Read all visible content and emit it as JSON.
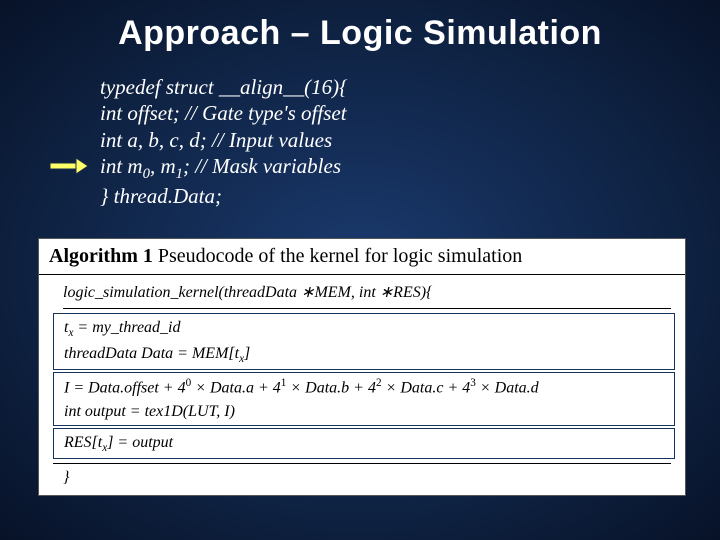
{
  "title": "Approach – Logic Simulation",
  "struct": {
    "l1": "typedef struct __align__(16){",
    "l2": "int offset; // Gate type's offset",
    "l3": "int a, b, c, d; // Input values",
    "l4_pre": "int m",
    "l4_sub0": "0",
    "l4_mid": ", m",
    "l4_sub1": "1",
    "l4_post": "; // Mask variables",
    "l5": "} thread.Data;"
  },
  "arrow_name": "arrow-right-icon",
  "algo": {
    "caption_bold": "Algorithm 1",
    "caption_rest": " Pseudocode of the kernel for logic simulation",
    "signature": "logic_simulation_kernel(threadData ∗MEM, int ∗RES){",
    "g1l1_lhs": "t",
    "g1l1_sub": "x",
    "g1l1_eq": " = my_thread_id",
    "g1l2_pre": "threadData Data = MEM[t",
    "g1l2_sub": "x",
    "g1l2_post": "]",
    "g2l1_pre": "I = Data.offset + 4",
    "g2l1_s0": "0",
    "g2l1_a": " × Data.a + 4",
    "g2l1_s1": "1",
    "g2l1_b": " × Data.b + 4",
    "g2l1_s2": "2",
    "g2l1_c": " × Data.c + 4",
    "g2l1_s3": "3",
    "g2l1_d": " × Data.d",
    "g2l2": "int output = tex1D(LUT, I)",
    "g3_pre": "RES[t",
    "g3_sub": "x",
    "g3_post": "] = output",
    "close": "}"
  }
}
